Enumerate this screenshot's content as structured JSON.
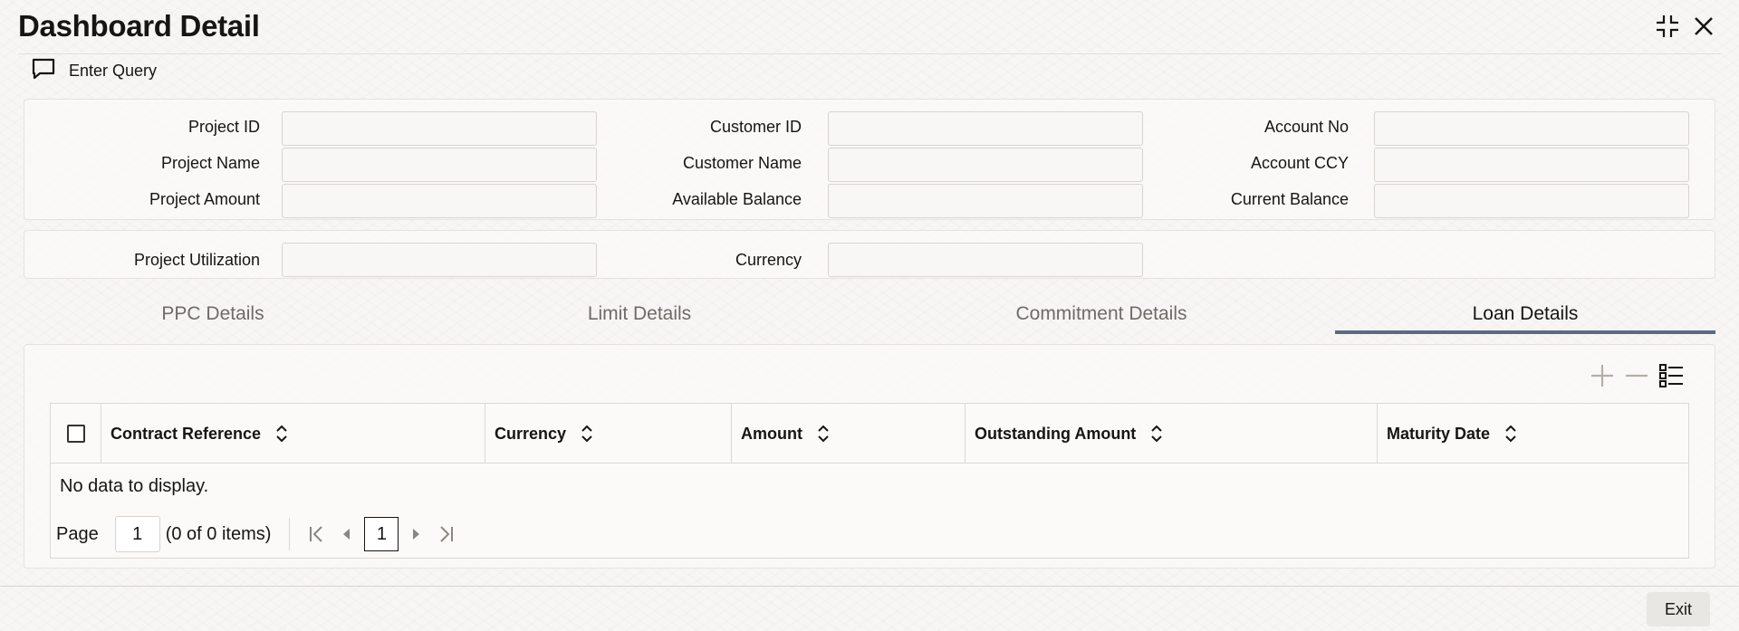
{
  "window": {
    "title": "Dashboard Detail",
    "icons": [
      "collapse-icon",
      "close-icon"
    ]
  },
  "toolbar": {
    "enter_query_label": "Enter Query",
    "enter_query_icon": "chat-bubble-icon"
  },
  "header_fields": {
    "project_id": {
      "label": "Project ID",
      "value": ""
    },
    "project_name": {
      "label": "Project Name",
      "value": ""
    },
    "project_amount": {
      "label": "Project Amount",
      "value": ""
    },
    "customer_id": {
      "label": "Customer ID",
      "value": ""
    },
    "customer_name": {
      "label": "Customer Name",
      "value": ""
    },
    "available_balance": {
      "label": "Available Balance",
      "value": ""
    },
    "account_no": {
      "label": "Account No",
      "value": ""
    },
    "account_ccy": {
      "label": "Account CCY",
      "value": ""
    },
    "current_balance": {
      "label": "Current Balance",
      "value": ""
    }
  },
  "utilization_fields": {
    "project_utilization": {
      "label": "Project Utilization",
      "value": ""
    },
    "currency": {
      "label": "Currency",
      "value": ""
    }
  },
  "tabs": [
    {
      "label": "PPC Details",
      "active": false
    },
    {
      "label": "Limit Details",
      "active": false
    },
    {
      "label": "Commitment Details",
      "active": false
    },
    {
      "label": "Loan Details",
      "active": true
    }
  ],
  "grid": {
    "toolbar_icons": [
      "add-row-icon",
      "delete-row-icon",
      "single-record-view-icon"
    ],
    "columns": [
      "Contract Reference",
      "Currency",
      "Amount",
      "Outstanding Amount",
      "Maturity Date"
    ],
    "rows": [],
    "empty_message": "No data to display.",
    "pager": {
      "page_label": "Page",
      "page_value": "1",
      "items_summary": "(0 of 0 items)",
      "current_page": "1"
    }
  },
  "footer": {
    "exit_label": "Exit"
  },
  "colors": {
    "active_tab_underline": "#5a6a85",
    "inactive_tab_text": "#6f6b66"
  }
}
